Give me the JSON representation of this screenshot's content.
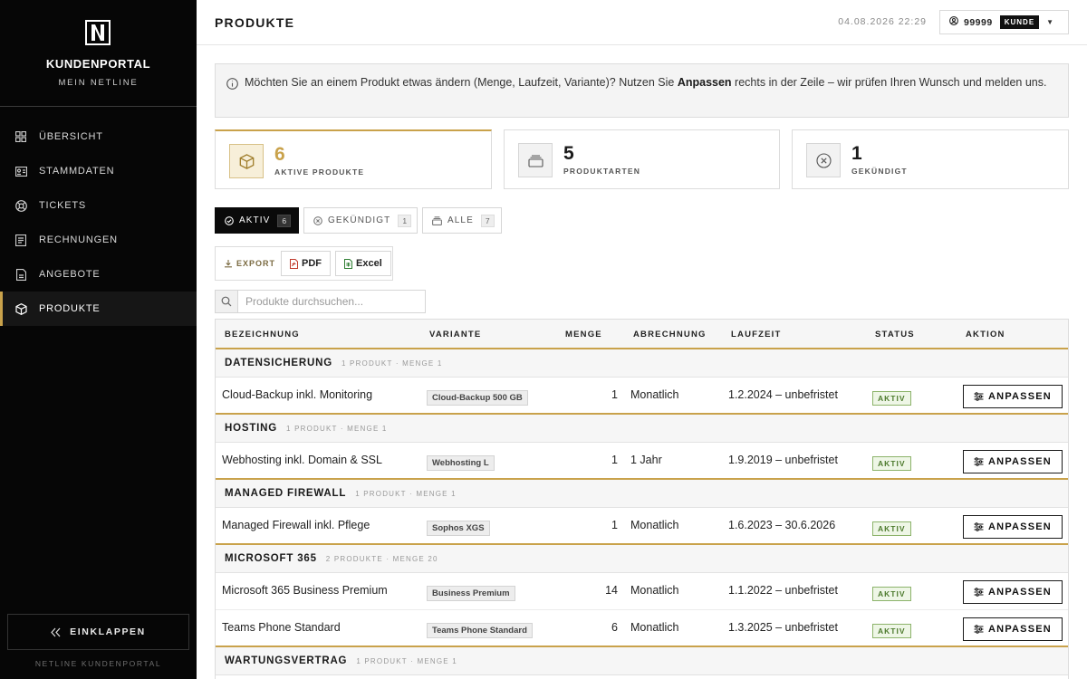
{
  "sidebar": {
    "brand_title": "KUNDENPORTAL",
    "brand_sub": "MEIN NETLINE",
    "items": [
      {
        "label": "ÜBERSICHT",
        "icon": "grid-icon"
      },
      {
        "label": "STAMMDATEN",
        "icon": "id-card-icon"
      },
      {
        "label": "TICKETS",
        "icon": "lifebuoy-icon"
      },
      {
        "label": "RECHNUNGEN",
        "icon": "invoice-icon"
      },
      {
        "label": "ANGEBOTE",
        "icon": "document-icon"
      },
      {
        "label": "PRODUKTE",
        "icon": "box-icon",
        "active": true
      }
    ],
    "collapse_label": "EINKLAPPEN",
    "footer": "NETLINE KUNDENPORTAL"
  },
  "header": {
    "title": "PRODUKTE",
    "datetime": "04.08.2026 22:29",
    "account_id": "99999",
    "account_role": "KUNDE"
  },
  "info": {
    "text_before": "Möchten Sie an einem Produkt etwas ändern (Menge, Laufzeit, Variante)? Nutzen Sie ",
    "emphasis": "Anpassen",
    "text_after": " rechts in der Zeile – wir prüfen Ihren Wunsch und melden uns."
  },
  "stats": [
    {
      "value": "6",
      "label": "AKTIVE PRODUKTE"
    },
    {
      "value": "5",
      "label": "PRODUKTARTEN"
    },
    {
      "value": "1",
      "label": "GEKÜNDIGT"
    }
  ],
  "tabs": [
    {
      "label": "AKTIV",
      "count": "6"
    },
    {
      "label": "GEKÜNDIGT",
      "count": "1"
    },
    {
      "label": "ALLE",
      "count": "7"
    }
  ],
  "export": {
    "label": "EXPORT",
    "pdf": "PDF",
    "excel": "Excel"
  },
  "search": {
    "placeholder": "Produkte durchsuchen..."
  },
  "table": {
    "headers": [
      "BEZEICHNUNG",
      "VARIANTE",
      "MENGE",
      "ABRECHNUNG",
      "LAUFZEIT",
      "STATUS",
      "AKTION"
    ],
    "action_label": "ANPASSEN",
    "groups": [
      {
        "name": "DATENSICHERUNG",
        "meta": "1 PRODUKT · MENGE 1",
        "rows": [
          {
            "name": "Cloud-Backup inkl. Monitoring",
            "variant": "Cloud-Backup 500 GB",
            "qty": "1",
            "billing": "Monatlich",
            "term": "1.2.2024 – unbefristet",
            "status": "AKTIV"
          }
        ]
      },
      {
        "name": "HOSTING",
        "meta": "1 PRODUKT · MENGE 1",
        "rows": [
          {
            "name": "Webhosting inkl. Domain & SSL",
            "variant": "Webhosting L",
            "qty": "1",
            "billing": "1 Jahr",
            "term": "1.9.2019 – unbefristet",
            "status": "AKTIV"
          }
        ]
      },
      {
        "name": "MANAGED FIREWALL",
        "meta": "1 PRODUKT · MENGE 1",
        "rows": [
          {
            "name": "Managed Firewall inkl. Pflege",
            "variant": "Sophos XGS",
            "qty": "1",
            "billing": "Monatlich",
            "term": "1.6.2023 – 30.6.2026",
            "status": "AKTIV"
          }
        ]
      },
      {
        "name": "MICROSOFT 365",
        "meta": "2 PRODUKTE · MENGE 20",
        "rows": [
          {
            "name": "Microsoft 365 Business Premium",
            "variant": "Business Premium",
            "qty": "14",
            "billing": "Monatlich",
            "term": "1.1.2022 – unbefristet",
            "status": "AKTIV"
          },
          {
            "name": "Teams Phone Standard",
            "variant": "Teams Phone Standard",
            "qty": "6",
            "billing": "Monatlich",
            "term": "1.3.2025 – unbefristet",
            "status": "AKTIV"
          }
        ]
      },
      {
        "name": "WARTUNGSVERTRAG",
        "meta": "1 PRODUKT · MENGE 1",
        "rows": []
      }
    ]
  }
}
